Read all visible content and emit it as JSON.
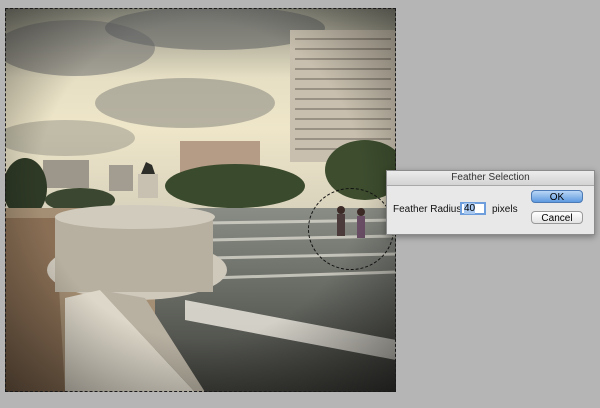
{
  "dialog": {
    "title": "Feather Selection",
    "radius_label": "Feather Radius:",
    "radius_value": "40",
    "unit_label": "pixels",
    "ok_label": "OK",
    "cancel_label": "Cancel"
  },
  "colors": {
    "workspace_bg": "#b5b5b5",
    "dialog_bg": "#e8e8e8",
    "ok_accent": "#5e9ae0"
  }
}
